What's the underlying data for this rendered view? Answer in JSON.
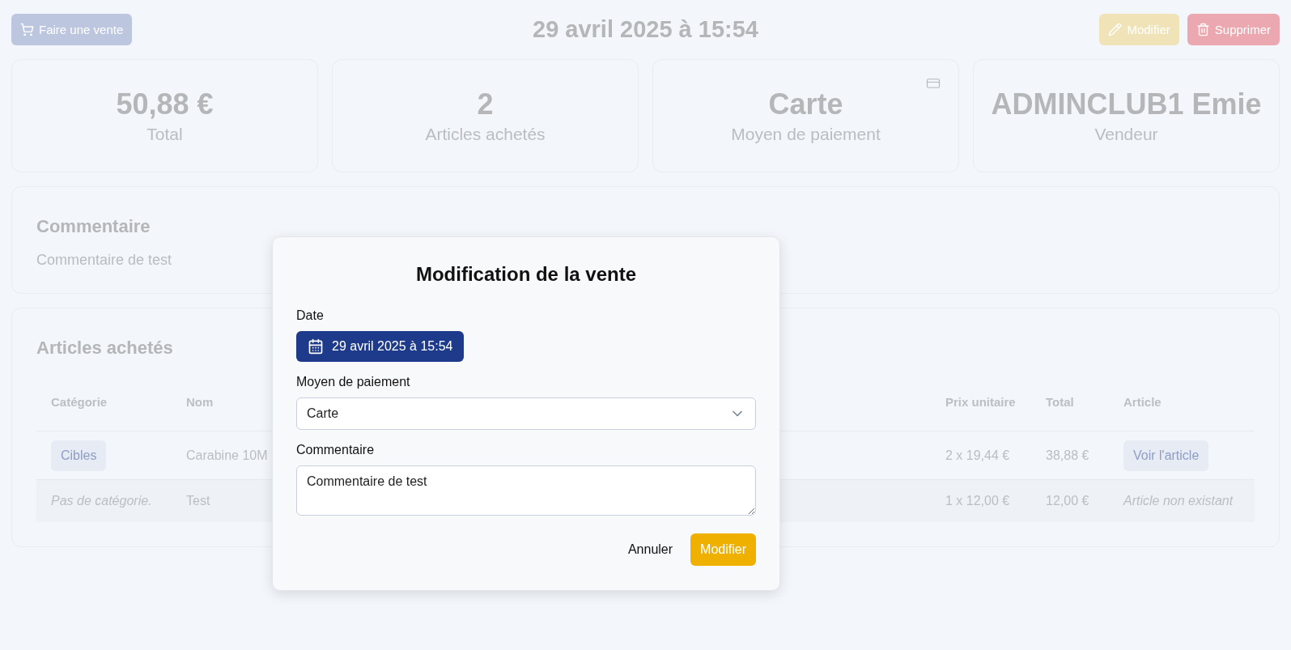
{
  "header": {
    "new_sale_button": "Faire une vente",
    "title": "29 avril 2025 à 15:54",
    "edit_button": "Modifier",
    "delete_button": "Supprimer"
  },
  "stats": [
    {
      "kind": "plain",
      "value": "50,88 €",
      "label": "Total"
    },
    {
      "kind": "plain",
      "value": "2",
      "label": "Articles achetés"
    },
    {
      "kind": "card",
      "value": "Carte",
      "label": "Moyen de paiement"
    },
    {
      "kind": "plain",
      "value": "ADMINCLUB1 Emie",
      "label": "Vendeur"
    }
  ],
  "comment": {
    "title": "Commentaire",
    "text": "Commentaire de test"
  },
  "articles": {
    "title": "Articles achetés",
    "columns": [
      "Catégorie",
      "Nom",
      "Prix unitaire",
      "Total",
      "Article"
    ],
    "rows": [
      {
        "category": {
          "kind": "tag",
          "text": "Cibles"
        },
        "name": "Carabine 10M",
        "unit_price": "2 x 19,44 €",
        "total": "38,88 €",
        "article": {
          "kind": "link",
          "text": "Voir l'article"
        }
      },
      {
        "category": {
          "kind": "note",
          "text": "Pas de catégorie."
        },
        "name": "Test",
        "unit_price": "1 x 12,00 €",
        "total": "12,00 €",
        "article": {
          "kind": "note",
          "text": "Article non existant"
        }
      }
    ]
  },
  "dialog": {
    "title": "Modification de la vente",
    "date_label": "Date",
    "date_value": "29 avril 2025 à 15:54",
    "payment_label": "Moyen de paiement",
    "payment_value": "Carte",
    "comment_label": "Commentaire",
    "comment_value": "Commentaire de test",
    "cancel_button": "Annuler",
    "submit_button": "Modifier"
  }
}
